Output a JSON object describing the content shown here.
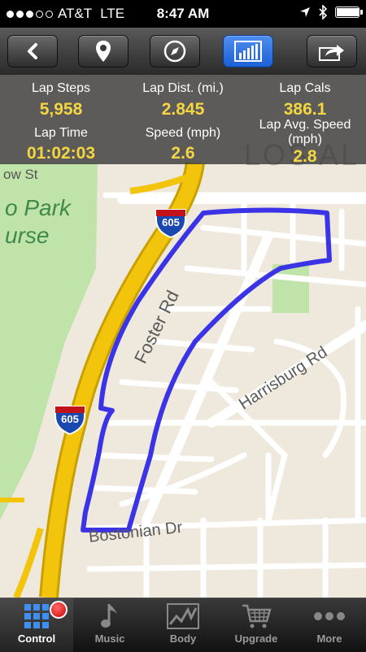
{
  "status_bar": {
    "carrier": "AT&T",
    "network": "LTE",
    "time": "8:47 AM",
    "signal_bars_filled": 3,
    "signal_bars_total": 5,
    "battery_level": 0.95
  },
  "toolbar": {
    "back_icon": "chevron-left-icon",
    "location_icon": "map-pin-icon",
    "compass_icon": "compass-icon",
    "stats_icon": "bar-chart-icon",
    "share_icon": "share-arrow-icon",
    "active_button": "stats"
  },
  "stats": {
    "lap_steps": {
      "label": "Lap Steps",
      "value": "5,958"
    },
    "lap_distance": {
      "label": "Lap Dist. (mi.)",
      "value": "2.845"
    },
    "lap_cals": {
      "label": "Lap Cals",
      "value": "386.1"
    },
    "lap_time": {
      "label": "Lap Time",
      "value": "01:02:03"
    },
    "speed": {
      "label": "Speed (mph)",
      "value": "2.6"
    },
    "lap_avg_speed": {
      "label_line1": "Lap Avg. Speed",
      "label_line2": "(mph)",
      "value": "2.8"
    }
  },
  "map": {
    "labels": {
      "park_line1": "o Park",
      "park_line2": "urse",
      "street_top": "ow St",
      "foster_rd": "Foster Rd",
      "harrisburg_rd": "Harrisburg Rd",
      "bostonian_dr": "Bostonian Dr",
      "city_partial": "LOS AL"
    },
    "highway_shield": {
      "top_text": "INTERSTATE",
      "number": "605"
    },
    "route_color": "#3a34e6",
    "highway_color": "#f2c40c",
    "park_color": "#bfe3a9"
  },
  "tabbar": {
    "tabs": [
      {
        "label": "Control",
        "icon": "keypad-icon"
      },
      {
        "label": "Music",
        "icon": "music-note-icon"
      },
      {
        "label": "Body",
        "icon": "body-chart-icon"
      },
      {
        "label": "Upgrade",
        "icon": "shopping-cart-icon"
      },
      {
        "label": "More",
        "icon": "more-dots-icon"
      }
    ],
    "active_tab": "Control"
  }
}
